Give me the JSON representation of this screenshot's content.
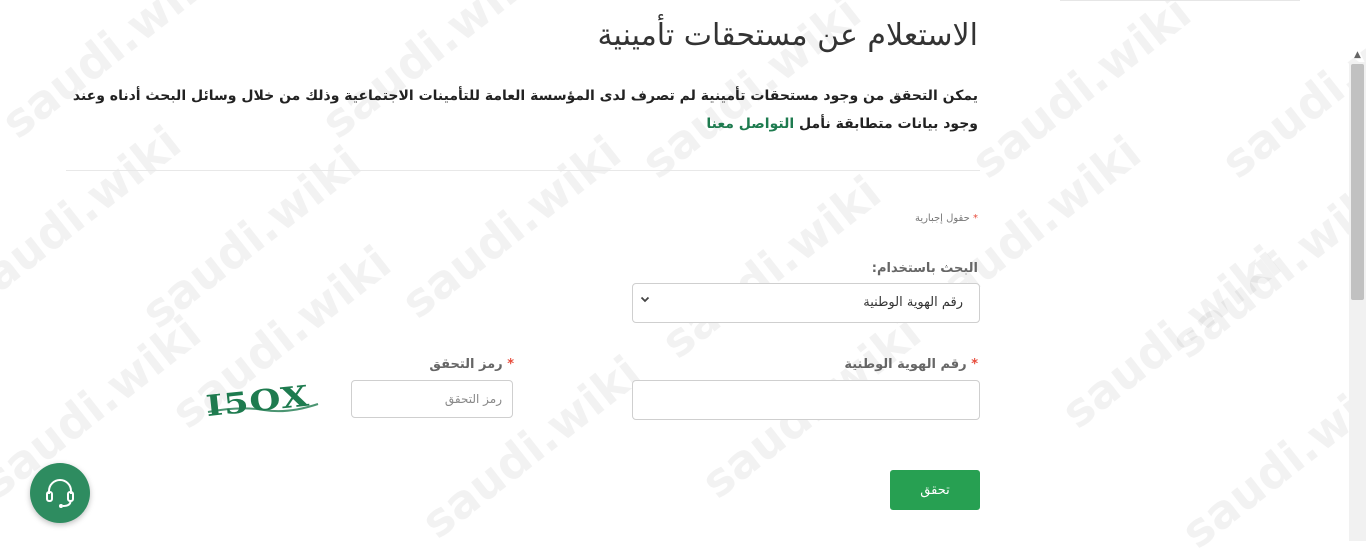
{
  "page": {
    "title": "الاستعلام عن مستحقات تأمينية",
    "description_main": "يمكن التحقق من وجود مستحقات تأمينية لم تصرف لدى المؤسسة العامة للتأمينات الاجتماعية وذلك من خلال وسائل البحث أدناه وعند وجود بيانات متطابقة نأمل",
    "description_link": "التواصل معنا",
    "required_note": "حقول إجبارية",
    "required_star": "*"
  },
  "form": {
    "search_by_label": "البحث باستخدام:",
    "search_by_selected": "رقم الهوية الوطنية",
    "national_id_label": "رقم الهوية الوطنية",
    "national_id_value": "",
    "captcha_label": "رمز التحقق",
    "captcha_placeholder": "رمز التحقق",
    "captcha_image_text": "I5OX",
    "submit_label": "تحقق"
  },
  "watermark": "saudi.wiki",
  "icons": {
    "chevron": "chevron-down-icon",
    "support": "headset-icon"
  },
  "colors": {
    "primary_green": "#27a052",
    "link_green": "#1e7b4f",
    "fab_green": "#2e8c60",
    "required_red": "#e74c3c",
    "captcha_green": "#1e7b4f"
  }
}
